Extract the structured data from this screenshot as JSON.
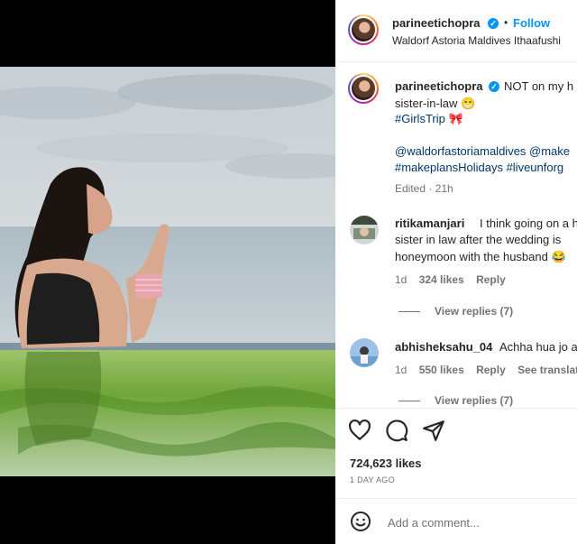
{
  "post": {
    "username": "parineetichopra",
    "follow_label": "Follow",
    "location": "Waldorf Astoria Maldives Ithaafushi",
    "dot": "•"
  },
  "caption": {
    "line1": "NOT on my h",
    "line2": "sister-in-law 😁",
    "line3": "#GirlsTrip 🎀",
    "line4": "@waldorfastoriamaldives @make",
    "line5": "#makeplansHolidays #liveunforg",
    "edited": "Edited · 21h"
  },
  "comments": [
    {
      "username": "ritikamanjari",
      "line1": "I think going on a h",
      "line2": "sister in law after the wedding is",
      "line3": "honeymoon with the husband 😂",
      "time": "1d",
      "likes": "324 likes",
      "reply": "Reply",
      "view_replies": "View replies (7)"
    },
    {
      "username": "abhisheksahu_04",
      "line1": "Achha hua jo a",
      "time": "1d",
      "likes": "550 likes",
      "reply": "Reply",
      "translation": "See translation",
      "view_replies": "View replies (7)"
    }
  ],
  "actions": {
    "like_icon": "heart-icon",
    "comment_icon": "comment-icon",
    "share_icon": "share-icon",
    "likes": "724,623 likes",
    "date": "1 DAY AGO"
  },
  "add_comment": {
    "placeholder": "Add a comment...",
    "emoji_icon": "emoji-icon"
  },
  "colors": {
    "accent": "#0095f6",
    "link": "#00376b",
    "secondary_text": "#737373"
  }
}
